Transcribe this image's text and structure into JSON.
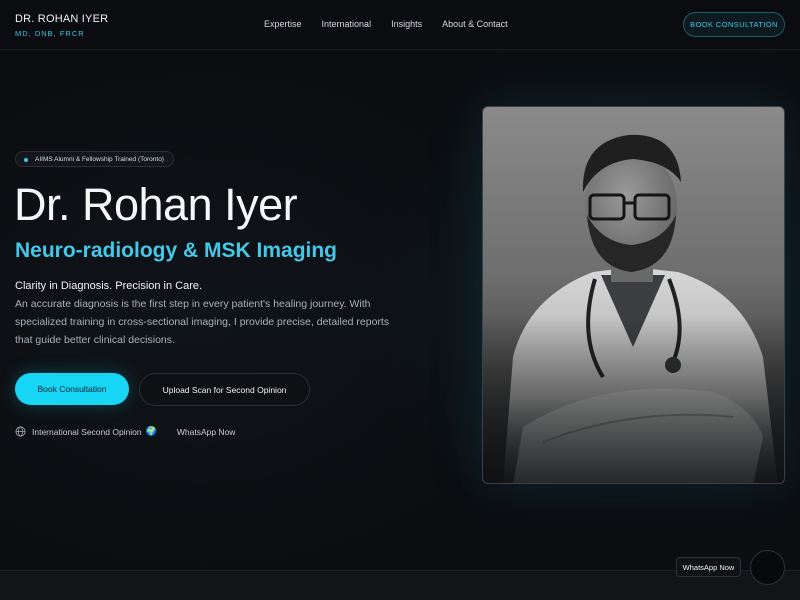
{
  "header": {
    "brand_name": "DR. ROHAN IYER",
    "brand_credentials": "MD, DNB, FRCR",
    "nav": [
      {
        "label": "Expertise"
      },
      {
        "label": "International"
      },
      {
        "label": "Insights"
      },
      {
        "label": "About & Contact"
      }
    ],
    "cta_label": "BOOK CONSULTATION"
  },
  "hero": {
    "badge": "AIIMS Alumni & Fellowship Trained (Toronto)",
    "title": "Dr. Rohan Iyer",
    "subtitle": "Neuro-radiology & MSK Imaging",
    "tagline": "Clarity in Diagnosis. Precision in Care.",
    "description": "An accurate diagnosis is the first step in every patient's healing journey. With specialized training in cross-sectional imaging, I provide precise, detailed reports that guide better clinical decisions.",
    "primary_button": "Book Consultation",
    "secondary_button": "Upload Scan for Second Opinion",
    "link_international": "International Second Opinion",
    "link_international_emoji": "🌍",
    "link_whatsapp": "WhatsApp Now"
  },
  "floating": {
    "whatsapp_tooltip": "WhatsApp Now"
  },
  "colors": {
    "accent": "#17d6f5",
    "background": "#0b0d10"
  },
  "icons": [
    "globe-icon",
    "whatsapp-icon"
  ]
}
